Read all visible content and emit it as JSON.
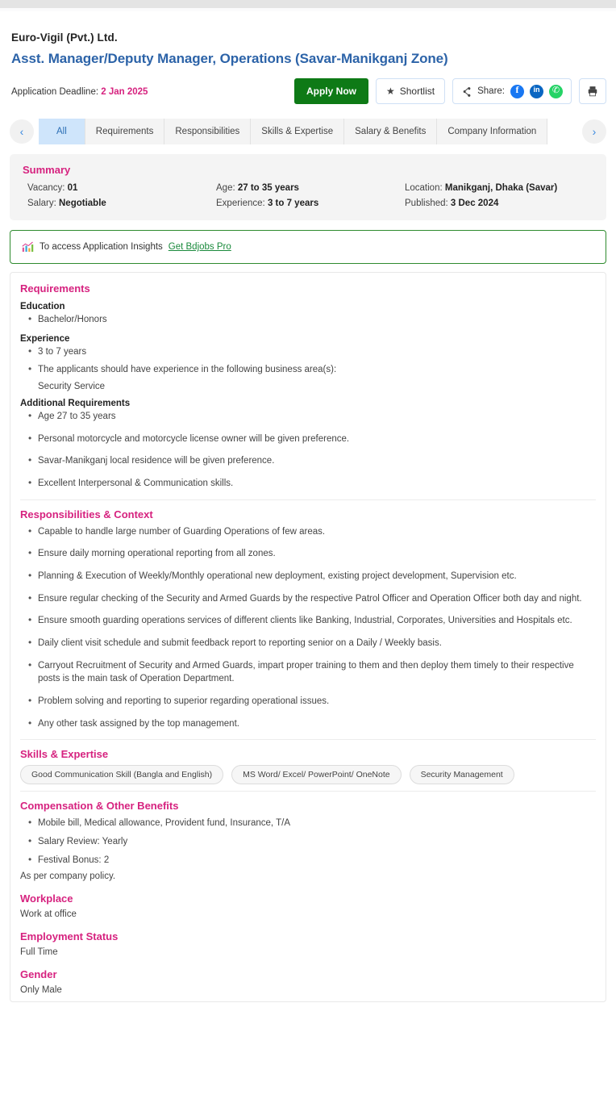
{
  "header": {
    "company": "Euro-Vigil (Pvt.) Ltd.",
    "job_title": "Asst. Manager/Deputy Manager, Operations (Savar-Manikganj Zone)",
    "deadline_label": "Application Deadline:",
    "deadline_date": "2 Jan 2025",
    "apply_label": "Apply Now",
    "shortlist_label": "Shortlist",
    "share_label": "Share:",
    "accent_blue": "#2c63a8",
    "accent_pink": "#d6227f",
    "apply_green": "#0e7a16"
  },
  "tabs": {
    "prev_icon": "chevron-left-icon",
    "next_icon": "chevron-right-icon",
    "items": [
      {
        "label": "All",
        "active": true
      },
      {
        "label": "Requirements",
        "active": false
      },
      {
        "label": "Responsibilities",
        "active": false
      },
      {
        "label": "Skills & Expertise",
        "active": false
      },
      {
        "label": "Salary & Benefits",
        "active": false
      },
      {
        "label": "Company Information",
        "active": false
      }
    ]
  },
  "summary": {
    "title": "Summary",
    "items": [
      {
        "label": "Vacancy:",
        "value": "01"
      },
      {
        "label": "Age:",
        "value": "27 to 35 years"
      },
      {
        "label": "Location:",
        "value": "Manikganj, Dhaka (Savar)"
      },
      {
        "label": "Salary:",
        "value": "Negotiable"
      },
      {
        "label": "Experience:",
        "value": "3 to 7 years"
      },
      {
        "label": "Published:",
        "value": "3 Dec 2024"
      }
    ]
  },
  "insights": {
    "text": "To access Application Insights",
    "link": "Get Bdjobs Pro",
    "border_color": "#2e8b2e",
    "link_color": "#1a8a3c"
  },
  "requirements": {
    "title": "Requirements",
    "education_label": "Education",
    "education": [
      "Bachelor/Honors"
    ],
    "experience_label": "Experience",
    "experience": [
      "3 to 7 years",
      "The applicants should have experience in the following business area(s):"
    ],
    "experience_sub": "Security Service",
    "additional_label": "Additional Requirements",
    "additional": [
      "Age 27 to 35 years",
      "Personal motorcycle and motorcycle license owner will be given preference.",
      "Savar-Manikganj local residence will be given preference.",
      "Excellent Interpersonal & Communication skills."
    ]
  },
  "responsibilities": {
    "title": "Responsibilities & Context",
    "items": [
      "Capable to handle large number of Guarding Operations of few areas.",
      "Ensure daily morning operational reporting from all zones.",
      "Planning & Execution of Weekly/Monthly operational new deployment, existing project development, Supervision etc.",
      "Ensure regular checking of the Security and Armed Guards by the respective Patrol Officer and Operation Officer both day and night.",
      "Ensure smooth guarding operations services of different clients like Banking, Industrial, Corporates, Universities and Hospitals etc.",
      "Daily client visit schedule and submit feedback report to reporting senior on a Daily / Weekly basis.",
      "Carryout Recruitment of Security and Armed Guards, impart proper training to them and then deploy them timely to their respective posts is the main task of Operation Department.",
      "Problem solving and reporting to superior regarding operational issues.",
      "Any other task assigned by the top management."
    ]
  },
  "skills": {
    "title": "Skills & Expertise",
    "items": [
      "Good Communication Skill (Bangla and English)",
      "MS Word/ Excel/ PowerPoint/ OneNote",
      "Security Management"
    ]
  },
  "compensation": {
    "title": "Compensation & Other Benefits",
    "items": [
      "Mobile bill, Medical allowance, Provident fund, Insurance, T/A",
      "Salary Review: Yearly",
      "Festival Bonus: 2"
    ],
    "note": "As per company policy."
  },
  "workplace": {
    "title": "Workplace",
    "value": "Work at office"
  },
  "employment": {
    "title": "Employment Status",
    "value": "Full Time"
  },
  "gender": {
    "title": "Gender",
    "value": "Only Male"
  }
}
